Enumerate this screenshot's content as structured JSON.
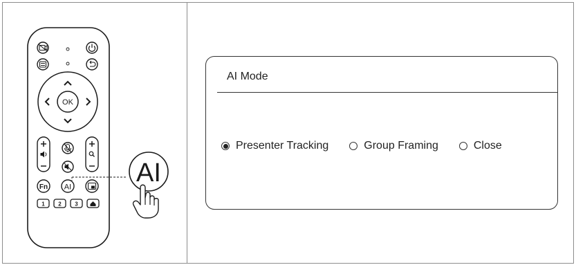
{
  "remote": {
    "ok_label": "OK",
    "fn_label": "Fn",
    "ai_label": "AI",
    "number_keys": [
      "1",
      "2",
      "3"
    ],
    "callout_label": "AI"
  },
  "ai_mode_panel": {
    "title": "AI Mode",
    "options": [
      {
        "label": "Presenter Tracking",
        "selected": true
      },
      {
        "label": "Group Framing",
        "selected": false
      },
      {
        "label": "Close",
        "selected": false
      }
    ]
  }
}
